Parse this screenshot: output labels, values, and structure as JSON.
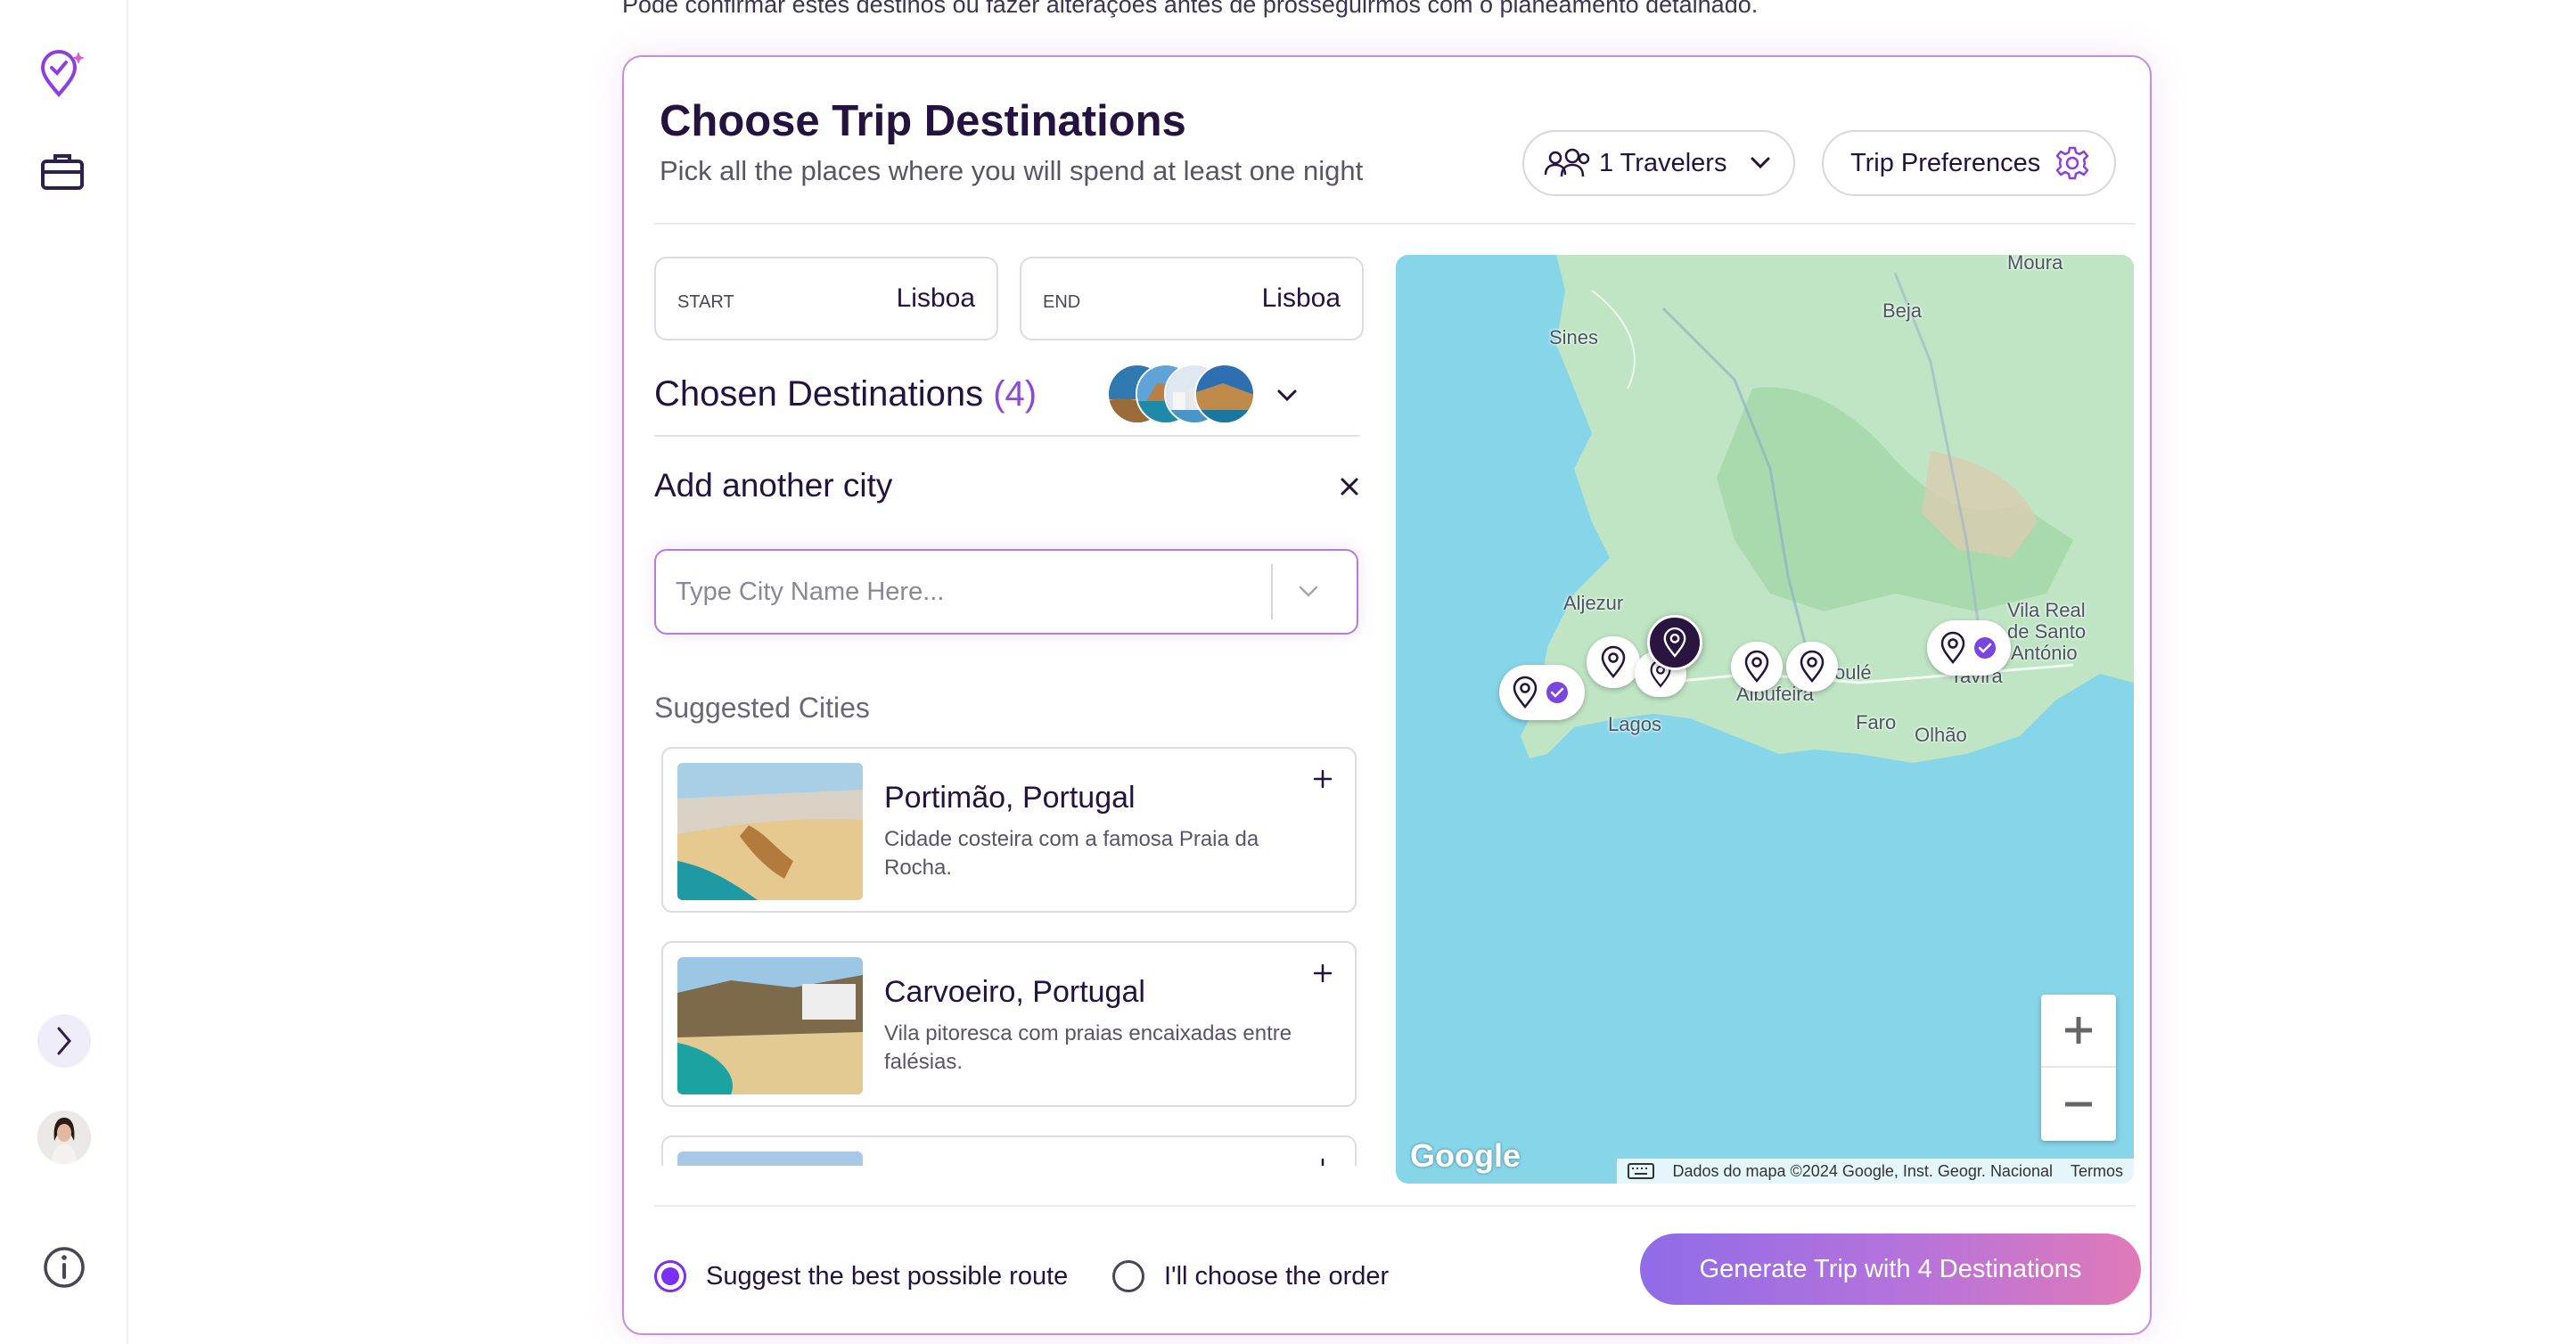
{
  "top_text": "Pode confirmar estes destinos ou fazer alterações antes de prosseguirmos com o planeamento detalhado.",
  "card": {
    "title": "Choose Trip Destinations",
    "subtitle": "Pick all the places where you will spend at least one night",
    "travelers_label": "1 Travelers",
    "preferences_label": "Trip Preferences"
  },
  "route": {
    "start_label": "START",
    "start_value": "Lisboa",
    "end_label": "END",
    "end_value": "Lisboa"
  },
  "chosen": {
    "label": "Chosen Destinations",
    "count": "(4)"
  },
  "add_city": {
    "title": "Add another city",
    "placeholder": "Type City Name Here..."
  },
  "suggested": {
    "title": "Suggested Cities",
    "items": [
      {
        "name": "Portimão, Portugal",
        "description": "Cidade costeira com a famosa Praia da Rocha."
      },
      {
        "name": "Carvoeiro, Portugal",
        "description": "Vila pitoresca com praias encaixadas entre falésias."
      }
    ]
  },
  "map": {
    "labels": {
      "moura": "Moura",
      "beja": "Beja",
      "sines": "Sines",
      "aljezur": "Aljezur",
      "vila_real_1": "Vila Real",
      "vila_real_2": "de Santo",
      "vila_real_3": "António",
      "tavira": "Tavira",
      "loule": "oulé",
      "albufeira": "Albufeira",
      "lagos": "Lagos",
      "faro": "Faro",
      "olhao": "Olhão"
    },
    "attribution": "Dados do mapa ©2024 Google, Inst. Geogr. Nacional",
    "terms": "Termos",
    "google": "Google"
  },
  "footer": {
    "option_best": "Suggest the best possible route",
    "option_manual": "I'll choose the order",
    "selected_option": "best",
    "generate_label": "Generate Trip with 4 Destinations"
  },
  "colors": {
    "accent": "#7b2ff2",
    "card_border": "#c78be0",
    "title": "#24123f",
    "button_gradient_start": "#8f6ce8",
    "button_gradient_end": "#e07ab8"
  }
}
